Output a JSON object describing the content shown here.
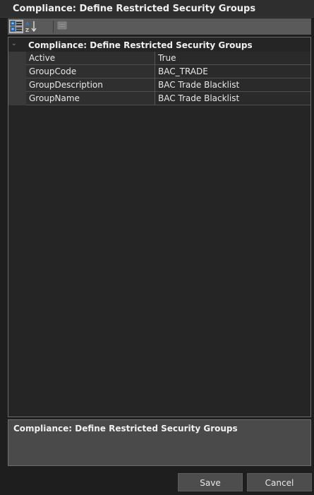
{
  "window": {
    "title": "Compliance: Define Restricted Security Groups"
  },
  "toolbar": {
    "buttons": [
      {
        "icon": "categorized-view-icon",
        "active": true
      },
      {
        "icon": "alphabetical-sort-icon",
        "active": false
      },
      {
        "icon": "property-pages-icon",
        "active": false
      }
    ]
  },
  "grid": {
    "category": "Compliance: Define Restricted Security Groups",
    "properties": [
      {
        "name": "Active",
        "value": "True"
      },
      {
        "name": "GroupCode",
        "value": "BAC_TRADE"
      },
      {
        "name": "GroupDescription",
        "value": "BAC Trade Blacklist"
      },
      {
        "name": "GroupName",
        "value": "BAC Trade Blacklist"
      }
    ]
  },
  "description": {
    "title": "Compliance: Define Restricted Security Groups"
  },
  "footer": {
    "save_label": "Save",
    "cancel_label": "Cancel"
  },
  "colors": {
    "background": "#1e1e1e",
    "toolbar": "#5a5a5a",
    "description_panel": "#4a4a4a"
  }
}
